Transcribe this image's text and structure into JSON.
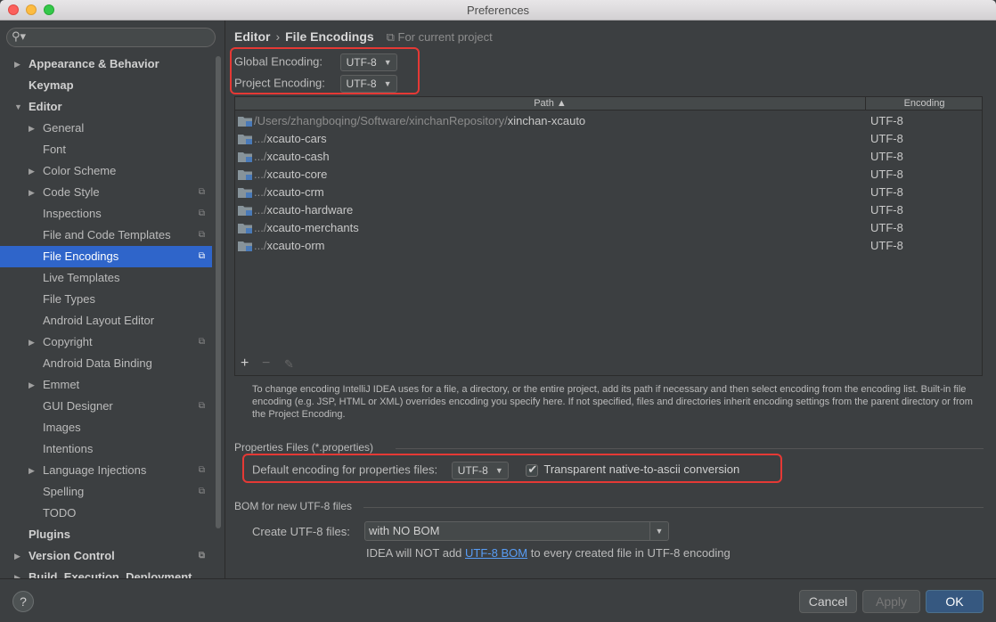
{
  "window": {
    "title": "Preferences"
  },
  "sidebar": {
    "search_placeholder": "",
    "items": [
      {
        "label": "Appearance & Behavior",
        "level": 0,
        "arrow": "▶",
        "bold": true
      },
      {
        "label": "Keymap",
        "level": 0,
        "arrow": "",
        "bold": true
      },
      {
        "label": "Editor",
        "level": 0,
        "arrow": "▼",
        "bold": true
      },
      {
        "label": "General",
        "level": 1,
        "arrow": "▶"
      },
      {
        "label": "Font",
        "level": 1,
        "arrow": ""
      },
      {
        "label": "Color Scheme",
        "level": 1,
        "arrow": "▶"
      },
      {
        "label": "Code Style",
        "level": 1,
        "arrow": "▶",
        "project": true
      },
      {
        "label": "Inspections",
        "level": 1,
        "arrow": "",
        "project": true
      },
      {
        "label": "File and Code Templates",
        "level": 1,
        "arrow": "",
        "project": true
      },
      {
        "label": "File Encodings",
        "level": 1,
        "arrow": "",
        "project": true,
        "selected": true
      },
      {
        "label": "Live Templates",
        "level": 1,
        "arrow": ""
      },
      {
        "label": "File Types",
        "level": 1,
        "arrow": ""
      },
      {
        "label": "Android Layout Editor",
        "level": 1,
        "arrow": ""
      },
      {
        "label": "Copyright",
        "level": 1,
        "arrow": "▶",
        "project": true
      },
      {
        "label": "Android Data Binding",
        "level": 1,
        "arrow": ""
      },
      {
        "label": "Emmet",
        "level": 1,
        "arrow": "▶"
      },
      {
        "label": "GUI Designer",
        "level": 1,
        "arrow": "",
        "project": true
      },
      {
        "label": "Images",
        "level": 1,
        "arrow": ""
      },
      {
        "label": "Intentions",
        "level": 1,
        "arrow": ""
      },
      {
        "label": "Language Injections",
        "level": 1,
        "arrow": "▶",
        "project": true
      },
      {
        "label": "Spelling",
        "level": 1,
        "arrow": "",
        "project": true
      },
      {
        "label": "TODO",
        "level": 1,
        "arrow": ""
      },
      {
        "label": "Plugins",
        "level": 0,
        "arrow": "",
        "bold": true
      },
      {
        "label": "Version Control",
        "level": 0,
        "arrow": "▶",
        "bold": true,
        "project": true
      },
      {
        "label": "Build, Execution, Deployment",
        "level": 0,
        "arrow": "▶",
        "bold": true
      }
    ]
  },
  "main": {
    "breadcrumb": {
      "parent": "Editor",
      "current": "File Encodings",
      "hint": "For current project"
    },
    "global_encoding": {
      "label": "Global Encoding:",
      "value": "UTF-8"
    },
    "project_encoding": {
      "label": "Project Encoding:",
      "value": "UTF-8"
    },
    "table": {
      "col_path": "Path ▲",
      "col_encoding": "Encoding",
      "rows": [
        {
          "dim": "/Users/zhangboqing/Software/xinchanRepository/",
          "path": "xinchan-xcauto",
          "encoding": "UTF-8"
        },
        {
          "dim": ".../",
          "path": "xcauto-cars",
          "encoding": "UTF-8"
        },
        {
          "dim": ".../",
          "path": "xcauto-cash",
          "encoding": "UTF-8"
        },
        {
          "dim": ".../",
          "path": "xcauto-core",
          "encoding": "UTF-8"
        },
        {
          "dim": ".../",
          "path": "xcauto-crm",
          "encoding": "UTF-8"
        },
        {
          "dim": ".../",
          "path": "xcauto-hardware",
          "encoding": "UTF-8"
        },
        {
          "dim": ".../",
          "path": "xcauto-merchants",
          "encoding": "UTF-8"
        },
        {
          "dim": ".../",
          "path": "xcauto-orm",
          "encoding": "UTF-8"
        }
      ],
      "toolbar": {
        "add": "+",
        "remove": "−",
        "edit": "✎"
      }
    },
    "description": "To change encoding IntelliJ IDEA uses for a file, a directory, or the entire project, add its path if necessary and then select encoding from the encoding list. Built-in file encoding (e.g. JSP, HTML or XML) overrides encoding you specify here. If not specified, files and directories inherit encoding settings from the parent directory or from the Project Encoding.",
    "properties": {
      "section": "Properties Files (*.properties)",
      "default_label": "Default encoding for properties files:",
      "default_value": "UTF-8",
      "native_label": "Transparent native-to-ascii conversion",
      "native_checked": true
    },
    "bom": {
      "section": "BOM for new UTF-8 files",
      "create_label": "Create UTF-8 files:",
      "create_value": "with NO BOM",
      "note_prefix": "IDEA will NOT add ",
      "note_link": "UTF-8 BOM",
      "note_suffix": " to every created file in UTF-8 encoding"
    }
  },
  "footer": {
    "help": "?",
    "cancel": "Cancel",
    "apply": "Apply",
    "ok": "OK"
  },
  "colors": {
    "accent": "#2f65ca",
    "highlight": "#e53935",
    "link": "#589df6"
  }
}
